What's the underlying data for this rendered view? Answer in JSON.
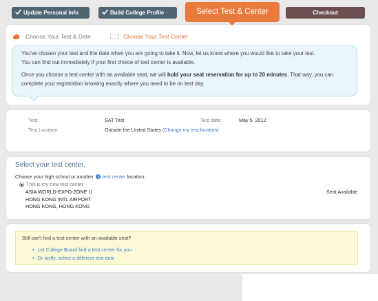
{
  "steps": [
    {
      "label": "Update Personal Info",
      "icon": "check-icon",
      "completed": true
    },
    {
      "label": "Build College Profile",
      "icon": "check-icon",
      "completed": true
    },
    {
      "label": "Select Test & Center",
      "current": true
    },
    {
      "label": "Checkout",
      "completed": false
    }
  ],
  "substeps": [
    {
      "label": "Choose Your Test & Date",
      "icon": "step-indicator-icon"
    },
    {
      "label": "Choose Your Test Center",
      "current": true
    }
  ],
  "intro": {
    "paragraph1": [
      "You've chosen your test and the date when you are going to take it. Now, let us know where you would like to take your test.",
      "You can find out immediately if your first choice of test center is available."
    ],
    "paragraph2": {
      "before_bold": "Once you choose a test center with an available seat, we will",
      "bold": "hold your seat reservation for up to 20 minutes",
      "after_bold": ". That way, you can",
      "continuation": "complete your registration knowing exactly where you need to be on test day."
    }
  },
  "test_summary": {
    "test_label": "Test:",
    "test_value": "SAT Test",
    "date_label": "Test date:",
    "date_value": "May 5, 2012",
    "location_label": "Test Location:",
    "location_value": "Outside the United States",
    "change_location_link": "(Change my test location)"
  },
  "center_select": {
    "heading": "Select your test center.",
    "prompt_before": "Choose your high school or another",
    "prompt_icon": "info-icon",
    "prompt_link": "test center",
    "prompt_after": "location:",
    "option": {
      "selected": true,
      "label": "This is my new test center",
      "address_lines": [
        "ASIA WORLD-EXPO-ZONE U",
        "HONG KONG INTL AIRPORT",
        "HONG KONG, HONG KONG"
      ],
      "availability": "Seat Available"
    }
  },
  "help": {
    "question": "Still can't find a test center with an available seat?",
    "links": [
      "Let College Board find a test center for you",
      "Or lastly, select a different test date"
    ]
  },
  "colors": {
    "completed_step": "#4f6571",
    "current_step": "#ea7a3c",
    "checkout_step": "#6c4e51",
    "callout_background": "#e9f5fa",
    "help_background": "#fcfad6",
    "link": "#3d7cc9",
    "heading": "#4b6d88"
  }
}
